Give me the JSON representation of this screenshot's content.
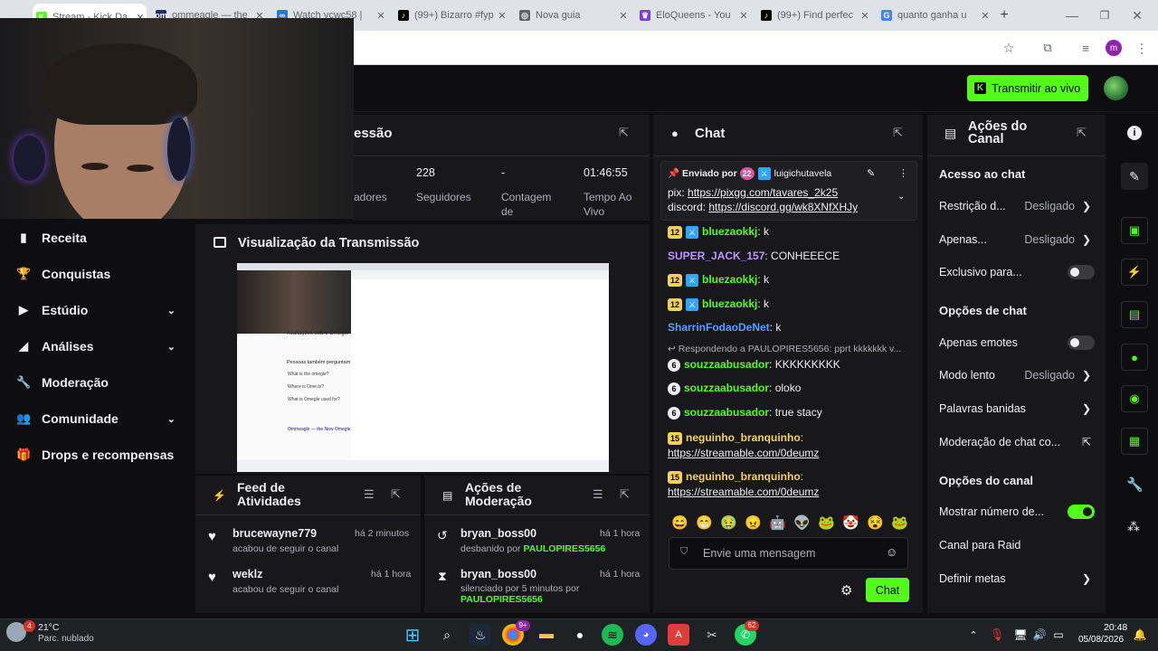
{
  "browser": {
    "tabs": [
      {
        "title": "Stream - Kick Da",
        "fav": "K",
        "color": "#53fc18",
        "active": true
      },
      {
        "title": "ommeagle — the",
        "fav": "om",
        "color": "#2b2b6b"
      },
      {
        "title": "Watch vcwc58 |",
        "fav": "∞",
        "color": "#1f7ae0"
      },
      {
        "title": "(99+) Bizarro #fyp",
        "fav": "♪",
        "color": "#000000"
      },
      {
        "title": "Nova guia",
        "fav": "◎",
        "color": "#5f6368"
      },
      {
        "title": "EloQueens - You",
        "fav": "♛",
        "color": "#7c3aed"
      },
      {
        "title": "(99+) Find perfec",
        "fav": "♪",
        "color": "#000000"
      },
      {
        "title": "quanto ganha u",
        "fav": "G",
        "color": "#4285f4"
      }
    ],
    "new_tab_label": "+"
  },
  "topbar": {
    "go_live_label": "Transmitir ao vivo"
  },
  "sidebar": {
    "items": [
      {
        "label": "Receita",
        "icon": "bar-chart-icon",
        "expand": false
      },
      {
        "label": "Conquistas",
        "icon": "trophy-icon",
        "expand": false
      },
      {
        "label": "Estúdio",
        "icon": "camera-icon",
        "expand": true
      },
      {
        "label": "Análises",
        "icon": "analytics-icon",
        "expand": true
      },
      {
        "label": "Moderação",
        "icon": "wrench-icon",
        "expand": false
      },
      {
        "label": "Comunidade",
        "icon": "people-icon",
        "expand": true
      },
      {
        "label": "Drops e recompensas",
        "icon": "gift-icon",
        "expand": false
      }
    ]
  },
  "session": {
    "title": "essão",
    "stats": [
      {
        "value": "",
        "label": "adores"
      },
      {
        "value": "228",
        "label": "Seguidores"
      },
      {
        "value": "-",
        "label": "Contagem de"
      },
      {
        "value": "01:46:55",
        "label": "Tempo Ao Vivo"
      }
    ]
  },
  "preview": {
    "title": "Visualização da Transmissão",
    "doc_lines": [
      "Avaliações sobre Omegle",
      "Pessoas também perguntam",
      "What is the omegle?",
      "Where is Ome.tv?",
      "What is Omegle used for?",
      "Ommeagle — the New Omegle"
    ]
  },
  "feed": {
    "title": "Feed de Atividades",
    "items": [
      {
        "name": "brucewayne779",
        "time": "há 2 minutos",
        "sub": "acabou de seguir o canal"
      },
      {
        "name": "weklz",
        "time": "há 1 hora",
        "sub": "acabou de seguir o canal"
      }
    ]
  },
  "modactions": {
    "title": "Ações de Moderação",
    "items": [
      {
        "name": "bryan_boss00",
        "time": "há 1 hora",
        "sub": "desbanido por",
        "by": "PAULOPIRES5656"
      },
      {
        "name": "bryan_boss00",
        "time": "há 1 hora",
        "sub": "silenciado por 5 minutos por",
        "by": "PAULOPIRES5656"
      }
    ]
  },
  "chat": {
    "title": "Chat",
    "pinned": {
      "sent_by": "Enviado por",
      "badge": "22",
      "user": "luigichutavela",
      "pix_label": "pix:",
      "pix_link": "https://pixgg.com/tavares_2k25",
      "discord_label": "discord:",
      "discord_link": "https://discord.gg/wk8XNfXHJy"
    },
    "messages": [
      {
        "badge": "12",
        "mod": true,
        "user": "bluezaokkj",
        "color": "#53fc18",
        "text": ": k"
      },
      {
        "badge": "",
        "mod": false,
        "user": "SUPER_JACK_157",
        "color": "#bf94ff",
        "text": ": CONHEEECE"
      },
      {
        "badge": "12",
        "mod": true,
        "user": "bluezaokkj",
        "color": "#53fc18",
        "text": ": k"
      },
      {
        "badge": "12",
        "mod": true,
        "user": "bluezaokkj",
        "color": "#53fc18",
        "text": ": k"
      },
      {
        "badge": "",
        "mod": false,
        "user": "SharrinFodaoDeNet",
        "color": "#5c9cff",
        "text": ": k"
      }
    ],
    "reply_to": "Respondendo a PAULOPIRES5656: pprt kkkkkkk v...",
    "messages2": [
      {
        "badge": "6",
        "user": "souzzaabusador",
        "text": ": KKKKKKKKK"
      },
      {
        "badge": "6",
        "user": "souzzaabusador",
        "text": ": oloko"
      },
      {
        "badge": "6",
        "user": "souzzaabusador",
        "text": ": true stacy"
      }
    ],
    "link_messages": [
      {
        "badge": "15",
        "user": "neguinho_branquinho",
        "text": ":",
        "link": "https://streamable.com/0deumz"
      },
      {
        "badge": "15",
        "user": "neguinho_branquinho",
        "text": ":",
        "link": "https://streamable.com/0deumz"
      }
    ],
    "emotes": [
      "😄",
      "😁",
      "🤢",
      "😠",
      "🤖",
      "👽",
      "🐸",
      "🤡",
      "😵",
      "🐸"
    ],
    "input_placeholder": "Envie uma mensagem",
    "send_label": "Chat"
  },
  "actions": {
    "title": "Ações do Canal",
    "sections": [
      {
        "heading": "Acesso ao chat"
      },
      {
        "heading": "Opções de chat"
      },
      {
        "heading": "Opções do canal"
      }
    ],
    "rows": [
      {
        "label": "Restrição d...",
        "value": "Desligado",
        "type": "chevron"
      },
      {
        "label": "Apenas...",
        "value": "Desligado",
        "type": "chevron"
      },
      {
        "label": "Exclusivo para...",
        "value": "",
        "type": "toggle-off"
      },
      {
        "label": "Apenas emotes",
        "value": "",
        "type": "toggle-off"
      },
      {
        "label": "Modo lento",
        "value": "Desligado",
        "type": "chevron"
      },
      {
        "label": "Palavras banidas",
        "value": "",
        "type": "chevron"
      },
      {
        "label": "Moderação de chat co...",
        "value": "",
        "type": "external"
      },
      {
        "label": "Mostrar número de...",
        "value": "",
        "type": "toggle-on"
      },
      {
        "label": "Canal para Raid",
        "value": "",
        "type": "none"
      },
      {
        "label": "Definir metas",
        "value": "",
        "type": "chevron"
      }
    ]
  },
  "taskbar": {
    "weather_temp": "21°C",
    "weather_desc": "Parc. nublado",
    "weather_badge": "4",
    "chrome_badge": "9+",
    "whatsapp_badge": "62",
    "time": "20:48",
    "date": "05/08/2026"
  },
  "colors": {
    "accent": "#53fc18",
    "panel": "#18181b",
    "bg": "#0e0e10"
  }
}
